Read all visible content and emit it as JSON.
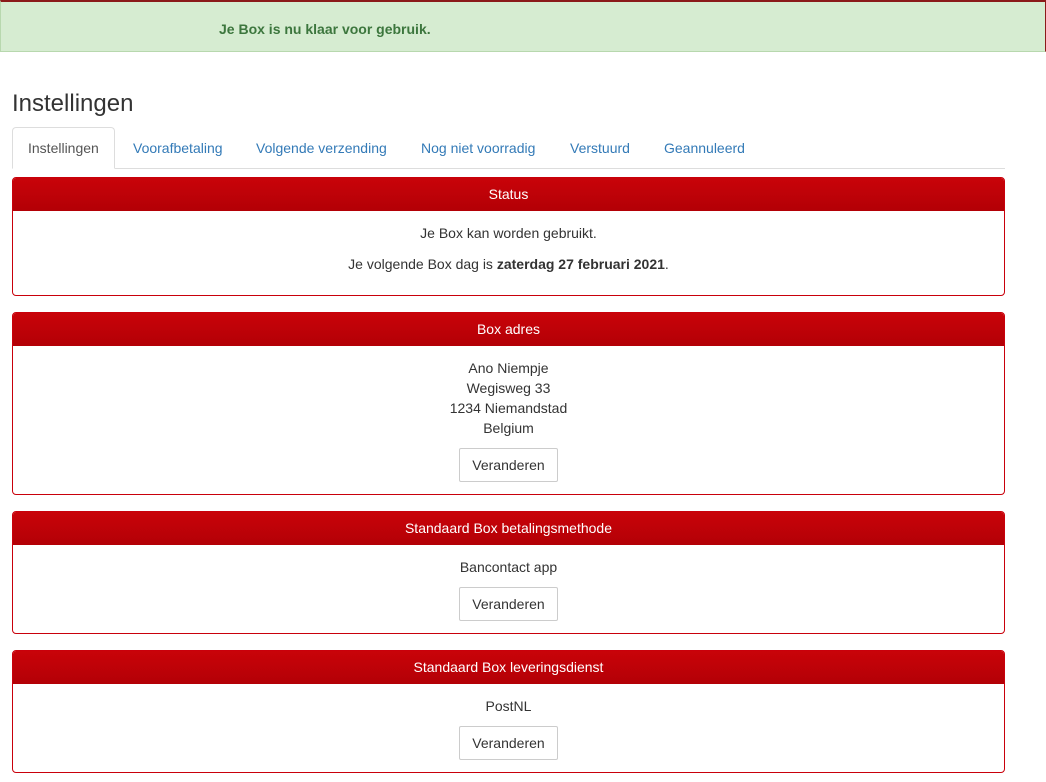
{
  "alert": {
    "message": "Je Box is nu klaar voor gebruik."
  },
  "page": {
    "title": "Instellingen"
  },
  "tabs": [
    {
      "label": "Instellingen",
      "active": true
    },
    {
      "label": "Voorafbetaling",
      "active": false
    },
    {
      "label": "Volgende verzending",
      "active": false
    },
    {
      "label": "Nog niet voorradig",
      "active": false
    },
    {
      "label": "Verstuurd",
      "active": false
    },
    {
      "label": "Geannuleerd",
      "active": false
    }
  ],
  "status_panel": {
    "heading": "Status",
    "line1": "Je Box kan worden gebruikt.",
    "line2_prefix": "Je volgende Box dag is ",
    "line2_date": "zaterdag 27 februari 2021",
    "line2_suffix": "."
  },
  "address_panel": {
    "heading": "Box adres",
    "name": "Ano Niempje",
    "street": "Wegisweg 33",
    "city": "1234 Niemandstad",
    "country": "Belgium",
    "button_label": "Veranderen"
  },
  "payment_panel": {
    "heading": "Standaard Box betalingsmethode",
    "method": "Bancontact app",
    "button_label": "Veranderen"
  },
  "delivery_panel": {
    "heading": "Standaard Box leveringsdienst",
    "service": "PostNL",
    "button_label": "Veranderen"
  },
  "colors": {
    "panel_header": "#c90309",
    "alert_bg": "#d6ecd1",
    "alert_text": "#3c763d",
    "link": "#337ab7"
  }
}
